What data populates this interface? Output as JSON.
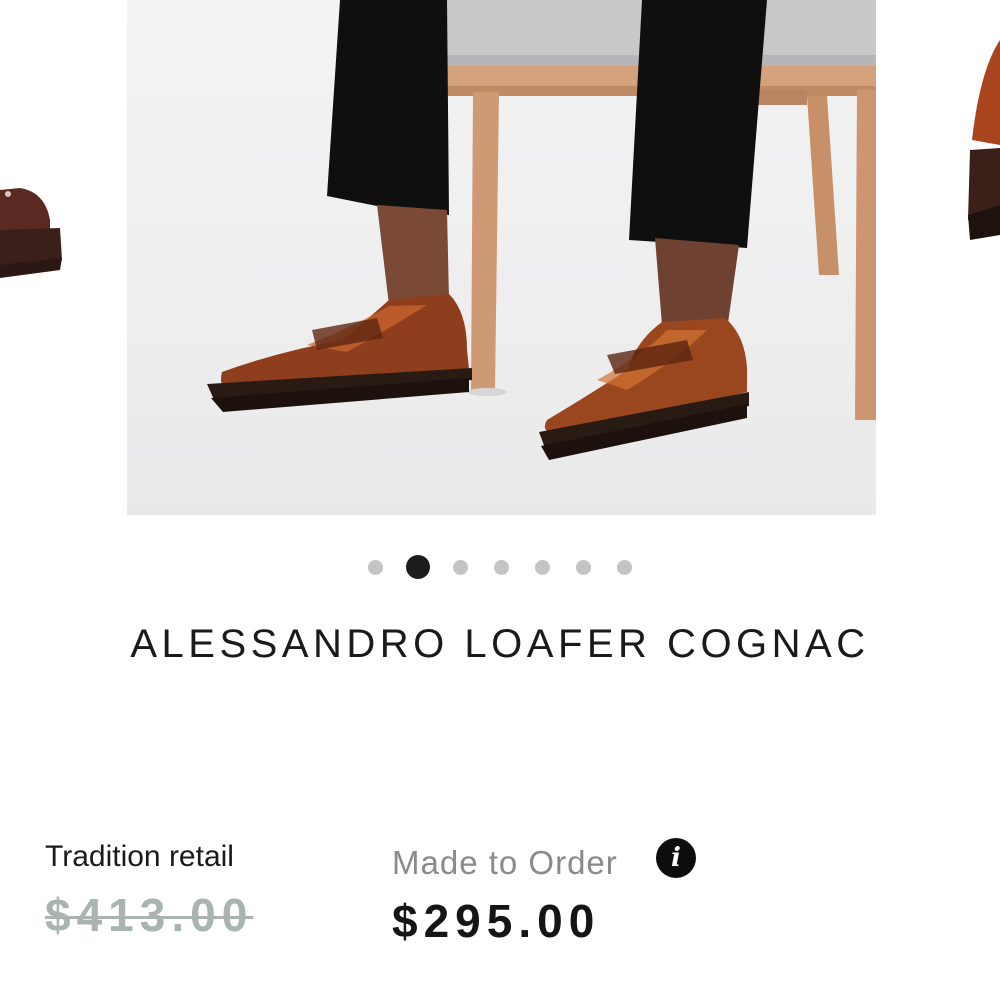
{
  "product": {
    "title": "ALESSANDRO LOAFER COGNAC"
  },
  "carousel": {
    "slide_count": 7,
    "active_index": 1
  },
  "icons": {
    "zoom": "search-icon",
    "info": "info-icon"
  },
  "pricing": {
    "retail_label": "Tradition retail",
    "retail_price": "$413.00",
    "made_to_order_label": "Made to Order",
    "made_to_order_price": "$295.00",
    "info_glyph": "i"
  },
  "colors": {
    "retail_price_strikethrough": "#a9b4ae",
    "active_dot": "#1c1c1c",
    "inactive_dot": "#c4c4c4"
  }
}
